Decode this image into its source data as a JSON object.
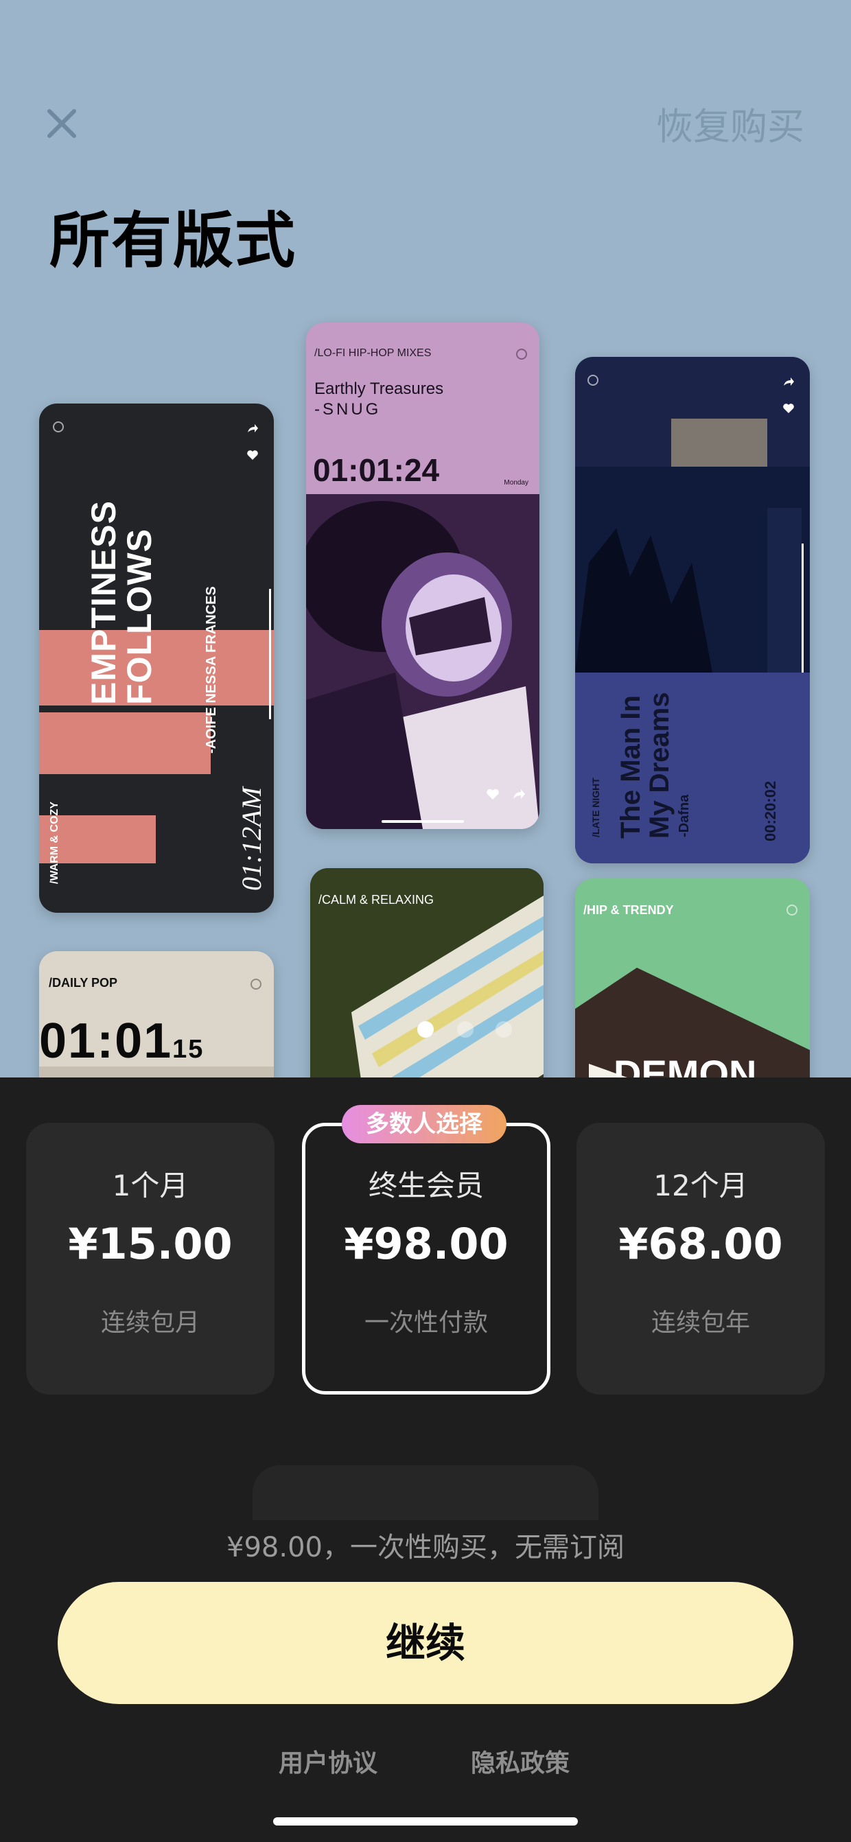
{
  "header": {
    "close_icon": "close-icon",
    "restore_label": "恢复购买",
    "title": "所有版式"
  },
  "cards": {
    "c1": {
      "title_line1": "EMPTINESS",
      "title_line2": "FOLLOWS",
      "artist": "-AOIFE NESSA FRANCES",
      "tag": "/WARM & COZY",
      "time": "01:12AM"
    },
    "c2": {
      "tag": "/LO-FI HIP-HOP MIXES",
      "song": "Earthly Treasures",
      "artist": "-SNUG",
      "time": "01:01:24",
      "day": "Monday"
    },
    "c3": {
      "tag": "/LATE NIGHT",
      "title_line1": "The Man In",
      "title_line2": "My Dreams",
      "artist": "-Dafna",
      "time": "00:20:02"
    },
    "c4": {
      "tag": "/DAILY POP",
      "time_main": "01:01",
      "time_sec": "15"
    },
    "c5": {
      "tag": "/CALM & RELAXING"
    },
    "c6": {
      "tag": "/HIP & TRENDY",
      "word": "DEMON"
    }
  },
  "plans": [
    {
      "name": "1个月",
      "price": "¥15.00",
      "note": "连续包月"
    },
    {
      "name": "终生会员",
      "price": "¥98.00",
      "note": "一次性付款"
    },
    {
      "name": "12个月",
      "price": "¥68.00",
      "note": "连续包年"
    }
  ],
  "badge": "多数人选择",
  "summary": "¥98.00，一次性购买，无需订阅",
  "cta": "继续",
  "links": {
    "terms": "用户协议",
    "privacy": "隐私政策"
  },
  "colors": {
    "background": "#9bb4c9",
    "sheet": "#1e1e1e",
    "cta": "#fcf2bf"
  }
}
